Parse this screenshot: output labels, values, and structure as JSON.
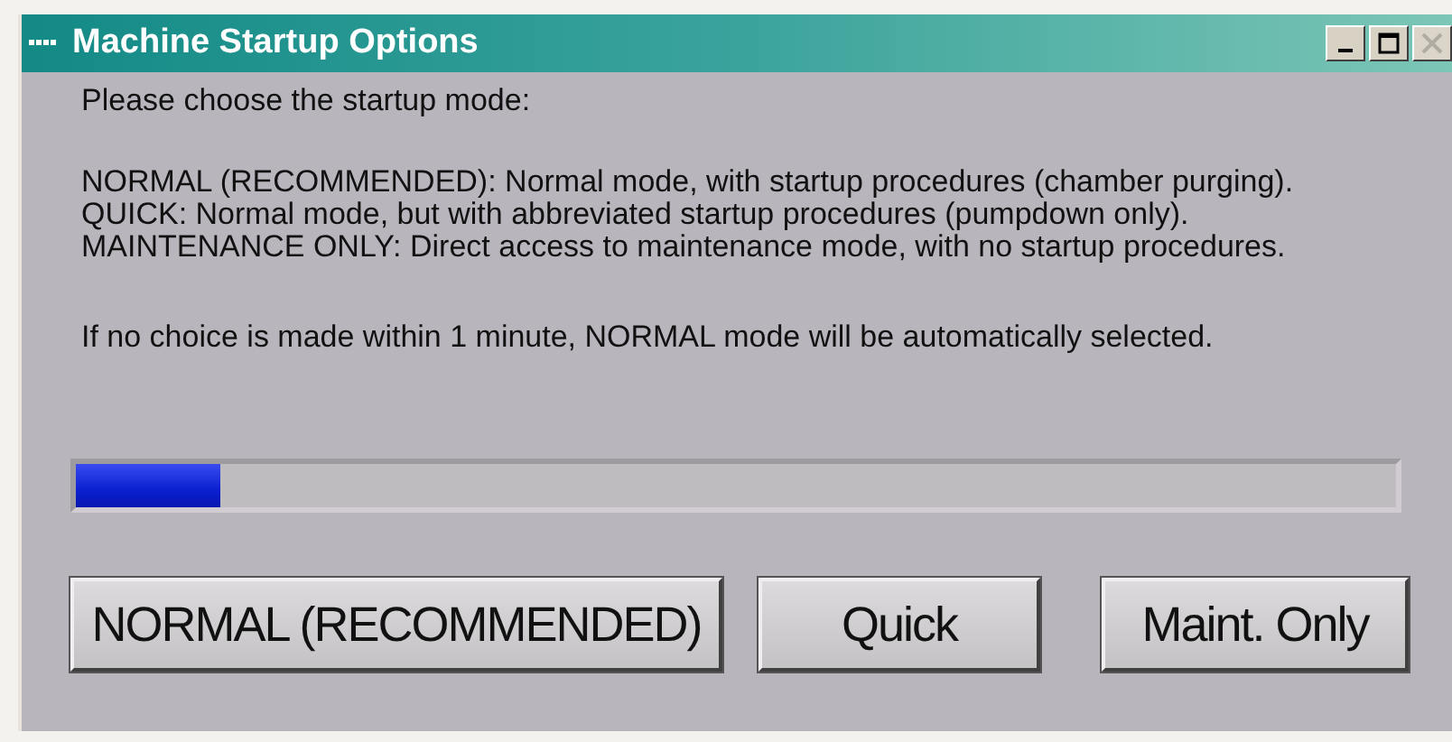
{
  "window": {
    "title": "Machine Startup Options",
    "controls": [
      {
        "kind": "minimize",
        "disabled": false
      },
      {
        "kind": "maximize",
        "disabled": false
      },
      {
        "kind": "close",
        "disabled": true
      }
    ]
  },
  "prompt": "Please choose the startup mode:",
  "mode_descriptions": [
    "NORMAL (RECOMMENDED): Normal mode, with startup procedures (chamber purging).",
    "QUICK: Normal mode, but with abbreviated startup procedures (pumpdown only).",
    "MAINTENANCE ONLY: Direct access to maintenance mode, with no startup procedures."
  ],
  "timeout_notice": "If no choice is made within 1 minute, NORMAL mode will be automatically selected.",
  "progress": {
    "level": 0.11
  },
  "buttons": [
    {
      "label": "NORMAL (RECOMMENDED)"
    },
    {
      "label": "Quick"
    },
    {
      "label": "Maint. Only"
    }
  ]
}
